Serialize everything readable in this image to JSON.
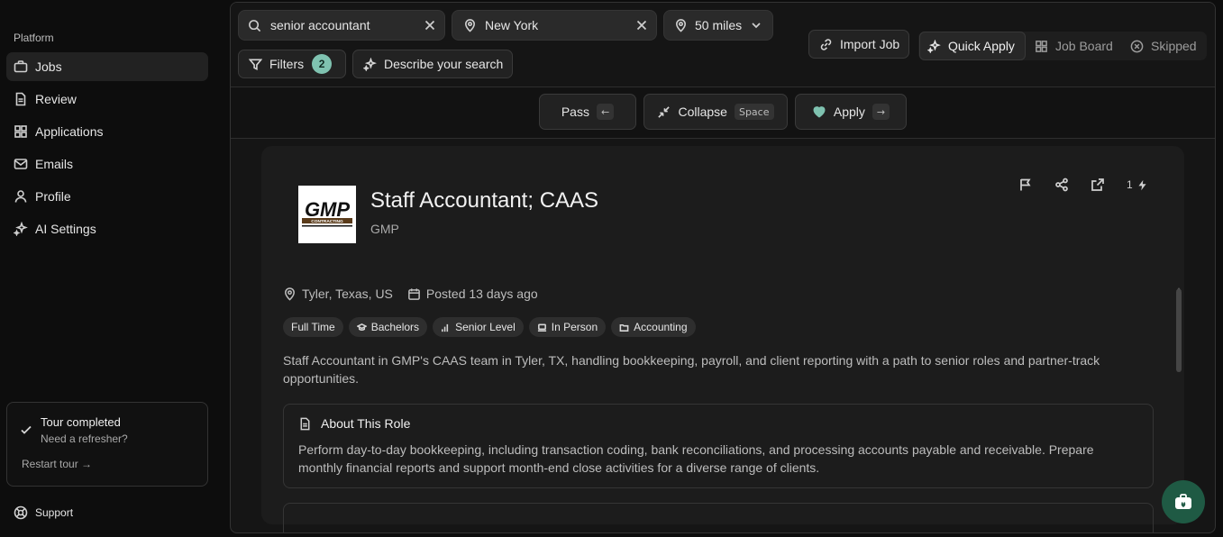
{
  "sidebar": {
    "section_label": "Platform",
    "items": [
      {
        "label": "Jobs",
        "icon": "briefcase-icon",
        "active": true
      },
      {
        "label": "Review",
        "icon": "document-icon"
      },
      {
        "label": "Applications",
        "icon": "grid-icon"
      },
      {
        "label": "Emails",
        "icon": "mail-icon"
      },
      {
        "label": "Profile",
        "icon": "user-icon"
      },
      {
        "label": "AI Settings",
        "icon": "sparkles-icon"
      }
    ],
    "tour": {
      "title": "Tour completed",
      "subtitle": "Need a refresher?",
      "link": "Restart tour →"
    },
    "support": "Support"
  },
  "search": {
    "query": "senior accountant",
    "location": "New York",
    "radius": "50 miles",
    "filters_label": "Filters",
    "filters_count": "2",
    "describe_label": "Describe your search"
  },
  "header_actions": {
    "import_job": "Import Job",
    "views": [
      "Quick Apply",
      "Job Board",
      "Skipped"
    ],
    "active_view": "Quick Apply"
  },
  "actions": {
    "pass": {
      "label": "Pass",
      "key": "←"
    },
    "collapse": {
      "label": "Collapse",
      "key": "Space"
    },
    "apply": {
      "label": "Apply",
      "key": "→"
    }
  },
  "job": {
    "title": "Staff Accountant; CAAS",
    "company": "GMP",
    "logo_text": "GMP",
    "logo_sub": "CONTRACTING",
    "boost_count": "1",
    "location": "Tyler, Texas, US",
    "posted": "Posted 13 days ago",
    "tags": [
      "Full Time",
      "Bachelors",
      "Senior Level",
      "In Person",
      "Accounting"
    ],
    "summary": "Staff Accountant in GMP's CAAS team in Tyler, TX, handling bookkeeping, payroll, and client reporting with a path to senior roles and partner-track opportunities.",
    "about_title": "About This Role",
    "about_body": "Perform day-to-day bookkeeping, including transaction coding, bank reconciliations, and processing accounts payable and receivable. Prepare monthly financial reports and support month-end close activities for a diverse range of clients."
  },
  "colors": {
    "accent": "#7fc2b0",
    "fab": "#1f5a44",
    "apply_heart": "#7fc2b0"
  }
}
